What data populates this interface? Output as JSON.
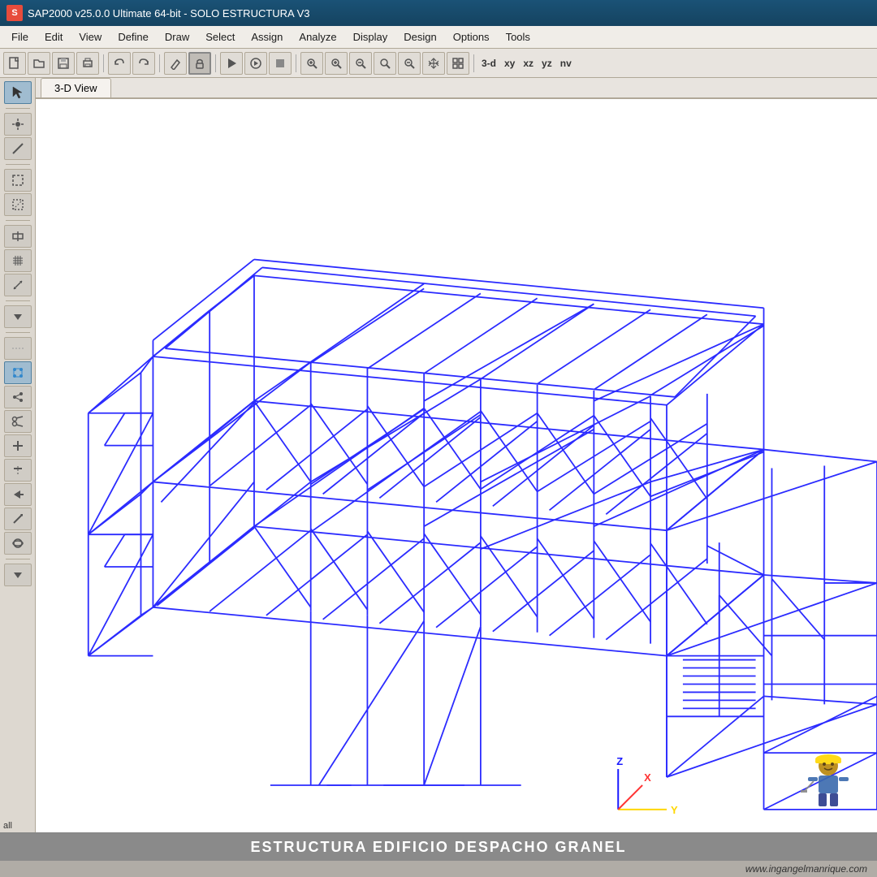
{
  "titlebar": {
    "logo": "S",
    "title": "SAP2000 v25.0.0 Ultimate 64-bit - SOLO ESTRUCTURA V3"
  },
  "menubar": {
    "items": [
      "File",
      "Edit",
      "View",
      "Define",
      "Draw",
      "Select",
      "Assign",
      "Analyze",
      "Display",
      "Design",
      "Options",
      "Tools"
    ]
  },
  "toolbar": {
    "view_modes": [
      "3-d",
      "xy",
      "xz",
      "yz",
      "nv"
    ]
  },
  "viewport": {
    "tab_label": "3-D View"
  },
  "bottom": {
    "title": "ESTRUCTURA EDIFICIO DESPACHO GRANEL",
    "website": "www.ingangelmanrique.com"
  },
  "sidebar": {
    "all_label": "all"
  },
  "icons": {
    "arrow": "↖",
    "pencil": "✏",
    "lock": "🔒",
    "play": "▶",
    "circle_play": "⏵",
    "zoom_in": "🔍",
    "zoom_out": "🔎",
    "pan": "✋",
    "new": "📄",
    "open": "📂",
    "save": "💾",
    "print": "🖨",
    "undo": "↩",
    "redo": "↪"
  }
}
